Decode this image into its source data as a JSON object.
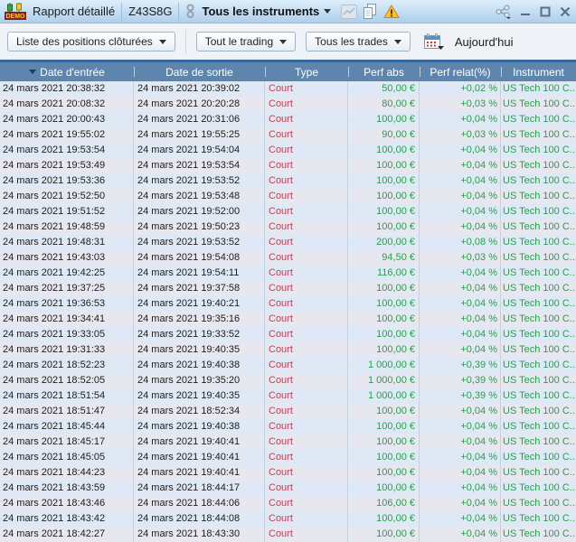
{
  "colors": {
    "accent-header": "#5e85ad",
    "header-strip": "#35699c",
    "row-light": "#dfe9f5",
    "row-alt": "#e7e7f0",
    "positive": "#26a04c",
    "negative": "#c23e52",
    "warning": "#fdbf2d"
  },
  "titlebar": {
    "demo_label": "DEMO",
    "title": "Rapport détaillé",
    "window_code": "Z43S8G",
    "instrument_selector": "Tous les instruments"
  },
  "toolbar": {
    "view_selector": "Liste des positions clôturées",
    "trading_filter": "Tout le trading",
    "trades_filter": "Tous les trades",
    "date_range": "Aujourd'hui"
  },
  "table": {
    "columns": {
      "entry": "Date d'entrée",
      "exit": "Date de sortie",
      "type": "Type",
      "perf_abs": "Perf abs",
      "perf_rel": "Perf relat(%)",
      "instrument": "Instrument"
    },
    "rows": [
      {
        "entry": "24 mars 2021 20:38:32",
        "exit": "24 mars 2021 20:39:02",
        "type": "Court",
        "perf_abs": "50,00 €",
        "perf_rel": "+0,02 %",
        "instrument": "US Tech 100 C..."
      },
      {
        "entry": "24 mars 2021 20:08:32",
        "exit": "24 mars 2021 20:20:28",
        "type": "Court",
        "perf_abs": "80,00 €",
        "perf_rel": "+0,03 %",
        "instrument": "US Tech 100 C..."
      },
      {
        "entry": "24 mars 2021 20:00:43",
        "exit": "24 mars 2021 20:31:06",
        "type": "Court",
        "perf_abs": "100,00 €",
        "perf_rel": "+0,04 %",
        "instrument": "US Tech 100 C..."
      },
      {
        "entry": "24 mars 2021 19:55:02",
        "exit": "24 mars 2021 19:55:25",
        "type": "Court",
        "perf_abs": "90,00 €",
        "perf_rel": "+0,03 %",
        "instrument": "US Tech 100 C..."
      },
      {
        "entry": "24 mars 2021 19:53:54",
        "exit": "24 mars 2021 19:54:04",
        "type": "Court",
        "perf_abs": "100,00 €",
        "perf_rel": "+0,04 %",
        "instrument": "US Tech 100 C..."
      },
      {
        "entry": "24 mars 2021 19:53:49",
        "exit": "24 mars 2021 19:53:54",
        "type": "Court",
        "perf_abs": "100,00 €",
        "perf_rel": "+0,04 %",
        "instrument": "US Tech 100 C..."
      },
      {
        "entry": "24 mars 2021 19:53:36",
        "exit": "24 mars 2021 19:53:52",
        "type": "Court",
        "perf_abs": "100,00 €",
        "perf_rel": "+0,04 %",
        "instrument": "US Tech 100 C..."
      },
      {
        "entry": "24 mars 2021 19:52:50",
        "exit": "24 mars 2021 19:53:48",
        "type": "Court",
        "perf_abs": "100,00 €",
        "perf_rel": "+0,04 %",
        "instrument": "US Tech 100 C..."
      },
      {
        "entry": "24 mars 2021 19:51:52",
        "exit": "24 mars 2021 19:52:00",
        "type": "Court",
        "perf_abs": "100,00 €",
        "perf_rel": "+0,04 %",
        "instrument": "US Tech 100 C..."
      },
      {
        "entry": "24 mars 2021 19:48:59",
        "exit": "24 mars 2021 19:50:23",
        "type": "Court",
        "perf_abs": "100,00 €",
        "perf_rel": "+0,04 %",
        "instrument": "US Tech 100 C..."
      },
      {
        "entry": "24 mars 2021 19:48:31",
        "exit": "24 mars 2021 19:53:52",
        "type": "Court",
        "perf_abs": "200,00 €",
        "perf_rel": "+0,08 %",
        "instrument": "US Tech 100 C..."
      },
      {
        "entry": "24 mars 2021 19:43:03",
        "exit": "24 mars 2021 19:54:08",
        "type": "Court",
        "perf_abs": "94,50 €",
        "perf_rel": "+0,03 %",
        "instrument": "US Tech 100 C..."
      },
      {
        "entry": "24 mars 2021 19:42:25",
        "exit": "24 mars 2021 19:54:11",
        "type": "Court",
        "perf_abs": "116,00 €",
        "perf_rel": "+0,04 %",
        "instrument": "US Tech 100 C..."
      },
      {
        "entry": "24 mars 2021 19:37:25",
        "exit": "24 mars 2021 19:37:58",
        "type": "Court",
        "perf_abs": "100,00 €",
        "perf_rel": "+0,04 %",
        "instrument": "US Tech 100 C..."
      },
      {
        "entry": "24 mars 2021 19:36:53",
        "exit": "24 mars 2021 19:40:21",
        "type": "Court",
        "perf_abs": "100,00 €",
        "perf_rel": "+0,04 %",
        "instrument": "US Tech 100 C..."
      },
      {
        "entry": "24 mars 2021 19:34:41",
        "exit": "24 mars 2021 19:35:16",
        "type": "Court",
        "perf_abs": "100,00 €",
        "perf_rel": "+0,04 %",
        "instrument": "US Tech 100 C..."
      },
      {
        "entry": "24 mars 2021 19:33:05",
        "exit": "24 mars 2021 19:33:52",
        "type": "Court",
        "perf_abs": "100,00 €",
        "perf_rel": "+0,04 %",
        "instrument": "US Tech 100 C..."
      },
      {
        "entry": "24 mars 2021 19:31:33",
        "exit": "24 mars 2021 19:40:35",
        "type": "Court",
        "perf_abs": "100,00 €",
        "perf_rel": "+0,04 %",
        "instrument": "US Tech 100 C..."
      },
      {
        "entry": "24 mars 2021 18:52:23",
        "exit": "24 mars 2021 19:40:38",
        "type": "Court",
        "perf_abs": "1 000,00 €",
        "perf_rel": "+0,39 %",
        "instrument": "US Tech 100 C..."
      },
      {
        "entry": "24 mars 2021 18:52:05",
        "exit": "24 mars 2021 19:35:20",
        "type": "Court",
        "perf_abs": "1 000,00 €",
        "perf_rel": "+0,39 %",
        "instrument": "US Tech 100 C..."
      },
      {
        "entry": "24 mars 2021 18:51:54",
        "exit": "24 mars 2021 19:40:35",
        "type": "Court",
        "perf_abs": "1 000,00 €",
        "perf_rel": "+0,39 %",
        "instrument": "US Tech 100 C..."
      },
      {
        "entry": "24 mars 2021 18:51:47",
        "exit": "24 mars 2021 18:52:34",
        "type": "Court",
        "perf_abs": "100,00 €",
        "perf_rel": "+0,04 %",
        "instrument": "US Tech 100 C..."
      },
      {
        "entry": "24 mars 2021 18:45:44",
        "exit": "24 mars 2021 19:40:38",
        "type": "Court",
        "perf_abs": "100,00 €",
        "perf_rel": "+0,04 %",
        "instrument": "US Tech 100 C..."
      },
      {
        "entry": "24 mars 2021 18:45:17",
        "exit": "24 mars 2021 19:40:41",
        "type": "Court",
        "perf_abs": "100,00 €",
        "perf_rel": "+0,04 %",
        "instrument": "US Tech 100 C..."
      },
      {
        "entry": "24 mars 2021 18:45:05",
        "exit": "24 mars 2021 19:40:41",
        "type": "Court",
        "perf_abs": "100,00 €",
        "perf_rel": "+0,04 %",
        "instrument": "US Tech 100 C..."
      },
      {
        "entry": "24 mars 2021 18:44:23",
        "exit": "24 mars 2021 19:40:41",
        "type": "Court",
        "perf_abs": "100,00 €",
        "perf_rel": "+0,04 %",
        "instrument": "US Tech 100 C..."
      },
      {
        "entry": "24 mars 2021 18:43:59",
        "exit": "24 mars 2021 18:44:17",
        "type": "Court",
        "perf_abs": "100,00 €",
        "perf_rel": "+0,04 %",
        "instrument": "US Tech 100 C..."
      },
      {
        "entry": "24 mars 2021 18:43:46",
        "exit": "24 mars 2021 18:44:06",
        "type": "Court",
        "perf_abs": "106,00 €",
        "perf_rel": "+0,04 %",
        "instrument": "US Tech 100 C..."
      },
      {
        "entry": "24 mars 2021 18:43:42",
        "exit": "24 mars 2021 18:44:08",
        "type": "Court",
        "perf_abs": "100,00 €",
        "perf_rel": "+0,04 %",
        "instrument": "US Tech 100 C..."
      },
      {
        "entry": "24 mars 2021 18:42:27",
        "exit": "24 mars 2021 18:43:30",
        "type": "Court",
        "perf_abs": "100,00 €",
        "perf_rel": "+0,04 %",
        "instrument": "US Tech 100 C..."
      }
    ]
  }
}
